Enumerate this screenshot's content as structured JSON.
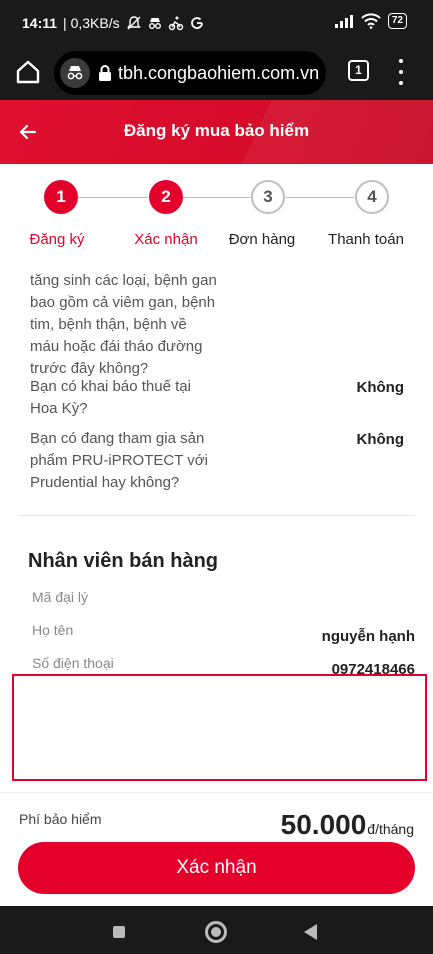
{
  "status_bar": {
    "time": "14:11",
    "speed": "| 0,3KB/s",
    "battery": "72",
    "icons": [
      "muted-bell-icon",
      "incognito-icon",
      "bike-icon",
      "g-icon",
      "signal-icon",
      "wifi-icon",
      "battery-icon"
    ]
  },
  "browser": {
    "url": "tbh.congbaohiem.com.vn",
    "tab_count": "1"
  },
  "header": {
    "title": "Đăng ký mua bảo hiểm"
  },
  "stepper": {
    "steps": [
      {
        "number": "1",
        "label": "Đăng ký",
        "state": "done"
      },
      {
        "number": "2",
        "label": "Xác nhận",
        "state": "current"
      },
      {
        "number": "3",
        "label": "Đơn hàng",
        "state": "pending"
      },
      {
        "number": "4",
        "label": "Thanh toán",
        "state": "pending"
      }
    ]
  },
  "questions": [
    {
      "text": "tăng sinh các loại, bệnh gan bao gồm cả viêm gan, bệnh tim, bệnh thận, bệnh về máu hoặc đái tháo đường trước đây không?",
      "answer": ""
    },
    {
      "text": "Bạn có khai báo thuế tại Hoa Kỳ?",
      "answer": "Không"
    },
    {
      "text": "Bạn có đang tham gia sản phẩm PRU-iPROTECT với Prudential hay không?",
      "answer": "Không"
    }
  ],
  "sales_staff": {
    "title": "Nhân viên bán hàng",
    "fields": [
      {
        "label": "Mã đại lý",
        "value": ""
      },
      {
        "label": "Họ tên",
        "value": "nguyễn hạnh"
      },
      {
        "label": "Số điện thoại",
        "value": "0972418466"
      }
    ]
  },
  "footer": {
    "fee_label": "Phí bảo hiểm",
    "fee_amount": "50.000",
    "fee_unit": "đ/tháng",
    "confirm_label": "Xác nhận"
  },
  "colors": {
    "brand": "#e4002b",
    "header": "#d60c2a"
  }
}
